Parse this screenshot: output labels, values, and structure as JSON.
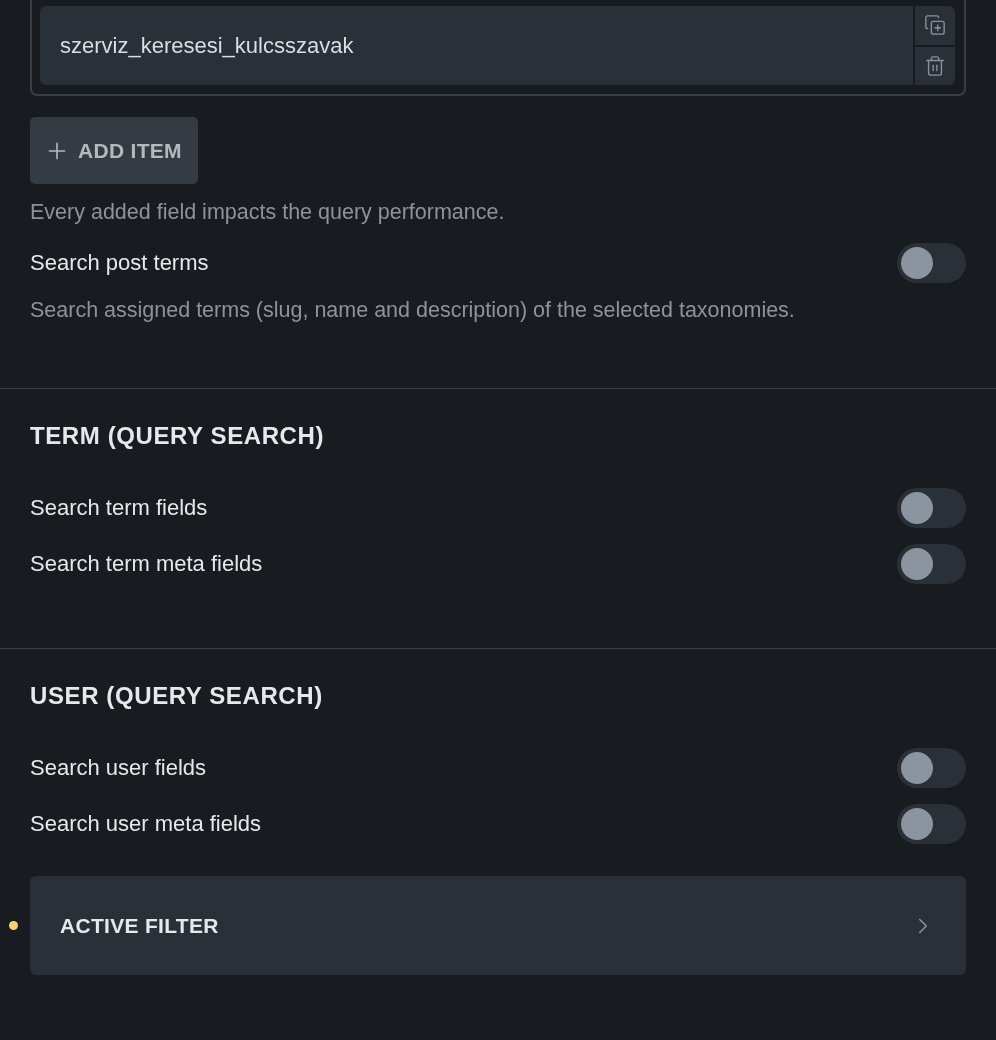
{
  "repeater": {
    "items": [
      {
        "value": "szerviz_keresesi_kulcsszavak"
      }
    ],
    "add_button": {
      "label": "ADD ITEM"
    },
    "help": "Every added field impacts the query performance."
  },
  "post_terms": {
    "label": "Search post terms",
    "on": false,
    "description": "Search assigned terms (slug, name and description) of the selected taxonomies."
  },
  "sections": [
    {
      "title": "TERM (QUERY SEARCH)",
      "toggles": [
        {
          "label": "Search term fields",
          "on": false
        },
        {
          "label": "Search term meta fields",
          "on": false
        }
      ]
    },
    {
      "title": "USER (QUERY SEARCH)",
      "toggles": [
        {
          "label": "Search user fields",
          "on": false
        },
        {
          "label": "Search user meta fields",
          "on": false
        }
      ]
    }
  ],
  "active_filter": {
    "label": "ACTIVE FILTER",
    "marked": true
  }
}
